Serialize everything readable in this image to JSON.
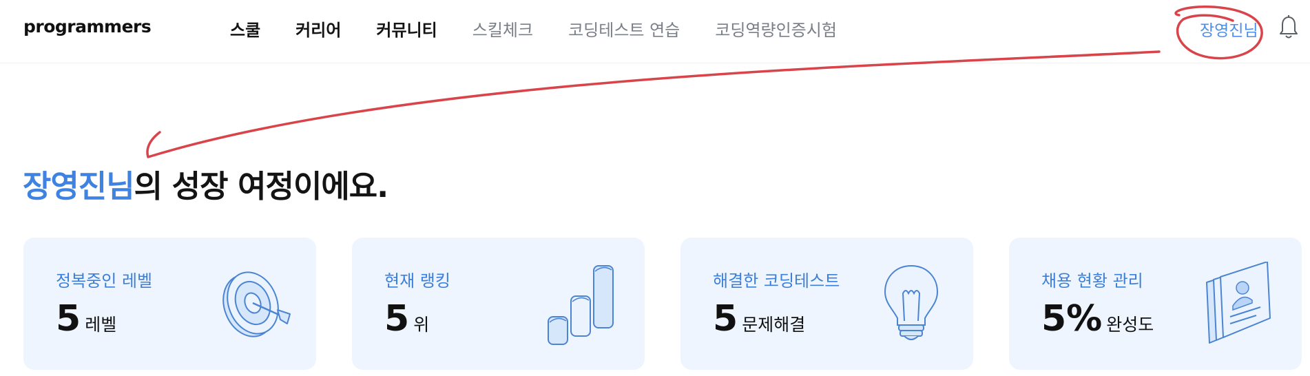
{
  "header": {
    "logo": "programmers",
    "nav": [
      {
        "label": "스쿨",
        "style": "bold"
      },
      {
        "label": "커리어",
        "style": "bold"
      },
      {
        "label": "커뮤니티",
        "style": "bold"
      },
      {
        "label": "스킬체크",
        "style": "light"
      },
      {
        "label": "코딩테스트 연습",
        "style": "light"
      },
      {
        "label": "코딩역량인증시험",
        "style": "light"
      }
    ],
    "user_name": "장영진님",
    "bell_icon": "bell-icon"
  },
  "headline": {
    "name": "장영진님",
    "rest": "의 성장 여정이에요."
  },
  "cards": [
    {
      "label": "정복중인 레벨",
      "value": "5",
      "unit": "레벨",
      "icon": "target-icon"
    },
    {
      "label": "현재 랭킹",
      "value": "5",
      "unit": "위",
      "icon": "bar-chart-icon"
    },
    {
      "label": "해결한 코딩테스트",
      "value": "5",
      "unit": "문제해결",
      "icon": "lightbulb-icon"
    },
    {
      "label": "채용 현황 관리",
      "value": "5%",
      "unit": "완성도",
      "icon": "profile-cards-icon"
    }
  ],
  "colors": {
    "accent": "#3e83e2",
    "card_bg": "#eef5fe",
    "annotation": "#d9434a"
  }
}
